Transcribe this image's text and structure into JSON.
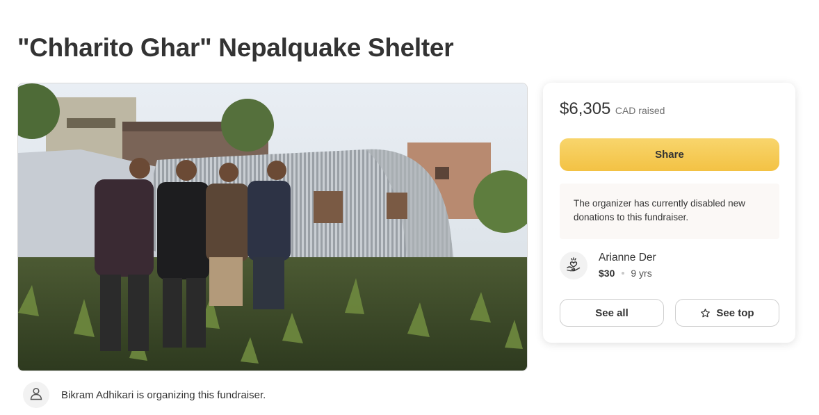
{
  "page": {
    "title": "\"Chharito Ghar\" Nepalquake Shelter"
  },
  "hero_image": {
    "alt_icon": "photo-icon"
  },
  "organizer": {
    "text": "Bikram Adhikari is organizing this fundraiser.",
    "icon": "user-icon"
  },
  "donation_card": {
    "amount": "$6,305",
    "currency_label": "CAD raised",
    "share_label": "Share",
    "notice": "The organizer has currently disabled new donations to this fundraiser.",
    "recent_donation": {
      "name": "Arianne Der",
      "amount": "$30",
      "age": "9 yrs",
      "icon": "heart-hand-icon"
    },
    "see_all_label": "See all",
    "see_top_label": "See top",
    "see_top_icon": "star-icon"
  },
  "colors": {
    "share_button": "#f3c244",
    "notice_background": "#fbf8f6",
    "text": "#333333"
  }
}
